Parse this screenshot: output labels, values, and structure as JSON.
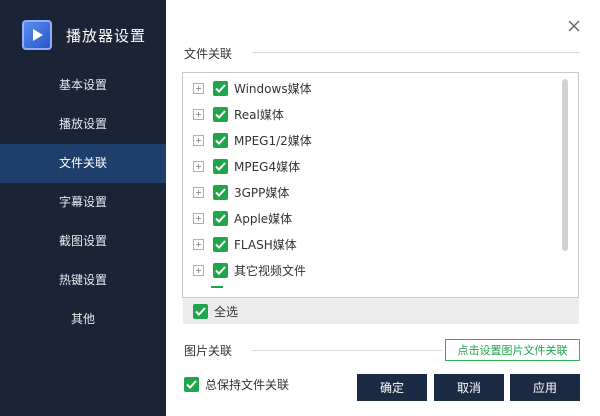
{
  "app": {
    "title": "播放器设置"
  },
  "sidebar": {
    "items": [
      {
        "label": "基本设置"
      },
      {
        "label": "播放设置"
      },
      {
        "label": "文件关联",
        "active": true
      },
      {
        "label": "字幕设置"
      },
      {
        "label": "截图设置"
      },
      {
        "label": "热键设置"
      },
      {
        "label": "其他"
      }
    ]
  },
  "file_assoc": {
    "section_title": "文件关联",
    "items": [
      {
        "label": "Windows媒体",
        "checked": true
      },
      {
        "label": "Real媒体",
        "checked": true
      },
      {
        "label": "MPEG1/2媒体",
        "checked": true
      },
      {
        "label": "MPEG4媒体",
        "checked": true
      },
      {
        "label": "3GPP媒体",
        "checked": true
      },
      {
        "label": "Apple媒体",
        "checked": true
      },
      {
        "label": "FLASH媒体",
        "checked": true
      },
      {
        "label": "其它视频文件",
        "checked": true
      }
    ],
    "select_all_label": "全选"
  },
  "image_assoc": {
    "section_title": "图片关联",
    "button_label": "点击设置图片文件关联"
  },
  "keep_assoc_label": "总保持文件关联",
  "buttons": {
    "ok": "确定",
    "cancel": "取消",
    "apply": "应用"
  },
  "colors": {
    "sidebar_bg": "#1b2436",
    "active_bg": "#1e3f6b",
    "check_green": "#1fa64a",
    "button_dark": "#1c2b44"
  },
  "icons": {
    "close": "close-icon",
    "logo": "player-logo-icon",
    "expand": "plus-expand-icon",
    "check": "checkmark-icon"
  }
}
